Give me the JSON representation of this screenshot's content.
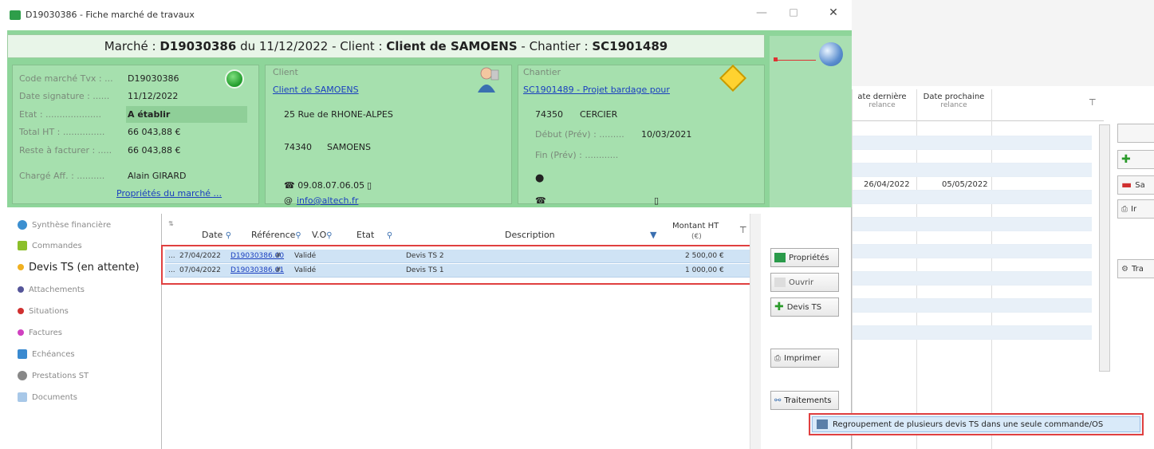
{
  "window": {
    "title": "D19030386 - Fiche marché de travaux",
    "minimize": "—",
    "maximize": "□",
    "close": "✕"
  },
  "banner": {
    "text_marche": "Marché : ",
    "code": "D19030386",
    "text_du": " du 11/12/2022 - Client : ",
    "client": "Client de SAMOENS",
    "text_chantier": " - Chantier : ",
    "chantier": "SC1901489"
  },
  "marche": {
    "code_label": "Code marché Tvx : ...",
    "code_value": "D19030386",
    "date_label": "Date signature : ......",
    "date_value": "11/12/2022",
    "etat_label": "Etat : ....................",
    "etat_value": "A établir",
    "total_label": "Total HT : ...............",
    "total_value": "66 043,88 €",
    "reste_label": "Reste à facturer : .....",
    "reste_value": "66 043,88 €",
    "charge_label": "Chargé Aff. : ..........",
    "charge_value": "Alain GIRARD",
    "props_link": "Propriétés du marché ..."
  },
  "client": {
    "heading": "Client",
    "name": "Client de SAMOENS",
    "address": "25 Rue de RHONE-ALPES",
    "postcode": "74340",
    "city": "SAMOENS",
    "phone": "☎ 09.08.07.06.05",
    "email_prefix": "@",
    "email": "info@altech.fr"
  },
  "chantier": {
    "heading": "Chantier",
    "name": "SC1901489 - Projet bardage pour",
    "postcode": "74350",
    "city": "CERCIER",
    "debut_label": "Début (Prév) : .........",
    "debut_value": "10/03/2021",
    "fin_label": "Fin (Prév) : ............",
    "phone_icon": "☎"
  },
  "nav": [
    {
      "label": "Synthèse financière",
      "color": "#3c8fd0"
    },
    {
      "label": "Commandes",
      "color": "#8cbf2a"
    },
    {
      "label": "Devis TS (en attente)",
      "color": "#f0b020"
    },
    {
      "label": "Attachements",
      "color": "#555599"
    },
    {
      "label": "Situations",
      "color": "#d03030"
    },
    {
      "label": "Factures",
      "color": "#d040c0"
    },
    {
      "label": "Echéances",
      "color": "#3a8ad0"
    },
    {
      "label": "Prestations ST",
      "color": "#888888"
    },
    {
      "label": "Documents",
      "color": "#a8c8e8"
    }
  ],
  "grid": {
    "headers": {
      "date": "Date",
      "reference": "Référence",
      "vo": "V.O",
      "etat": "Etat",
      "description": "Description",
      "montant": "Montant HT",
      "montant_sub": "(€)"
    },
    "rows": [
      {
        "dots": "...",
        "date": "27/04/2022",
        "reference": "D19030386.00",
        "vo": "#",
        "etat": "Validé",
        "description": "Devis TS 2",
        "montant": "2 500,00 €"
      },
      {
        "dots": "...",
        "date": "07/04/2022",
        "reference": "D19030386.01",
        "vo": "#",
        "etat": "Validé",
        "description": "Devis TS 1",
        "montant": "1 000,00 €"
      }
    ]
  },
  "actions": {
    "proprietes": "Propriétés",
    "ouvrir": "Ouvrir",
    "devis_ts": "Devis TS",
    "imprimer": "Imprimer",
    "traitements": "Traitements"
  },
  "popup": {
    "label": "Regroupement de plusieurs devis TS dans une seule commande/OS"
  },
  "background": {
    "col1": "ate dernière",
    "col1_sub": "relance",
    "col2": "Date prochaine",
    "col2_sub": "relance",
    "row_date1": "26/04/2022",
    "row_date2": "05/05/2022",
    "btn_s": "Sa",
    "btn_i": "Ir",
    "btn_tr": "Tra"
  }
}
